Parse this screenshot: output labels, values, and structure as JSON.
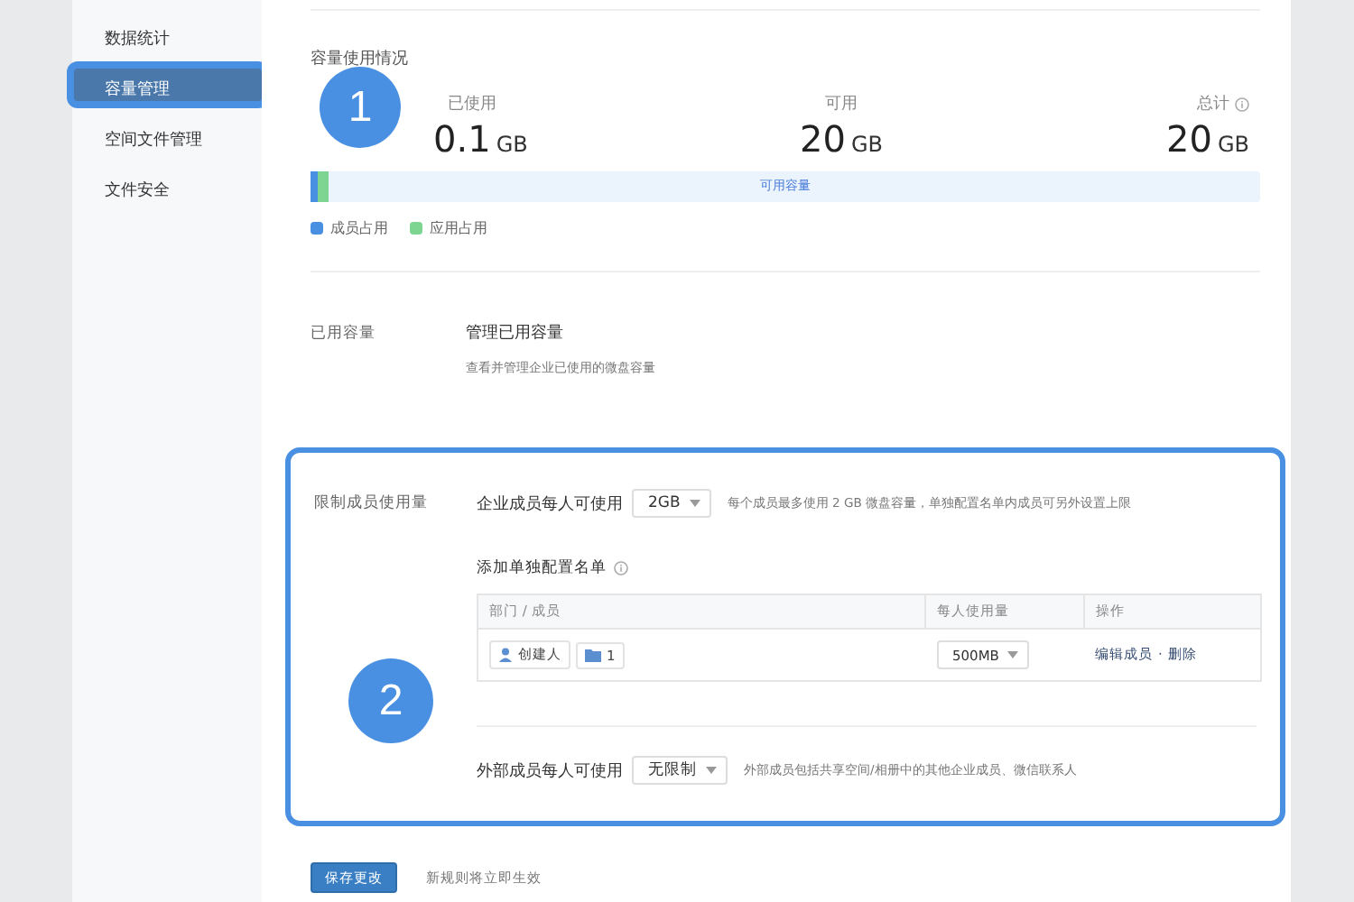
{
  "sidebar": {
    "items": [
      {
        "label": "数据统计",
        "selected": false
      },
      {
        "label": "容量管理",
        "selected": true
      },
      {
        "label": "空间文件管理",
        "selected": false
      },
      {
        "label": "文件安全",
        "selected": false
      }
    ]
  },
  "usage": {
    "title": "容量使用情况",
    "stats": [
      {
        "label": "已使用",
        "value": "0.1",
        "unit": "GB",
        "info": false
      },
      {
        "label": "可用",
        "value": "20",
        "unit": "GB",
        "info": false
      },
      {
        "label": "总计",
        "value": "20",
        "unit": "GB",
        "info": true
      }
    ],
    "bar": {
      "label": "可用容量",
      "segments": [
        {
          "level": 0.008,
          "color": "#4a90e2"
        },
        {
          "level": 0.011,
          "color": "#7ed491"
        }
      ]
    },
    "legend": [
      {
        "label": "成员占用",
        "color": "#4a90e2"
      },
      {
        "label": "应用占用",
        "color": "#7ed491"
      }
    ]
  },
  "used_capacity": {
    "label": "已用容量",
    "title": "管理已用容量",
    "description": "查看并管理企业已使用的微盘容量"
  },
  "limit": {
    "label": "限制成员使用量",
    "highlighted": true,
    "member": {
      "label": "企业成员每人可使用",
      "value": "2GB",
      "hint": "每个成员最多使用 2 GB 微盘容量，单独配置名单内成员可另外设置上限"
    },
    "list_title": "添加单独配置名单",
    "table": {
      "columns": [
        "部门 / 成员",
        "每人使用量",
        "操作"
      ],
      "rows": [
        {
          "member": "创建人",
          "folder": "1",
          "quota": "500MB",
          "actions": [
            "编辑成员",
            "删除"
          ],
          "separator": "·"
        }
      ]
    },
    "external": {
      "label": "外部成员每人可使用",
      "value": "无限制",
      "hint": "外部成员包括共享空间/相册中的其他企业成员、微信联系人"
    }
  },
  "footer": {
    "button": "保存更改",
    "note": "新规则将立即生效"
  },
  "callouts": [
    {
      "number": "1"
    },
    {
      "number": "2"
    }
  ]
}
